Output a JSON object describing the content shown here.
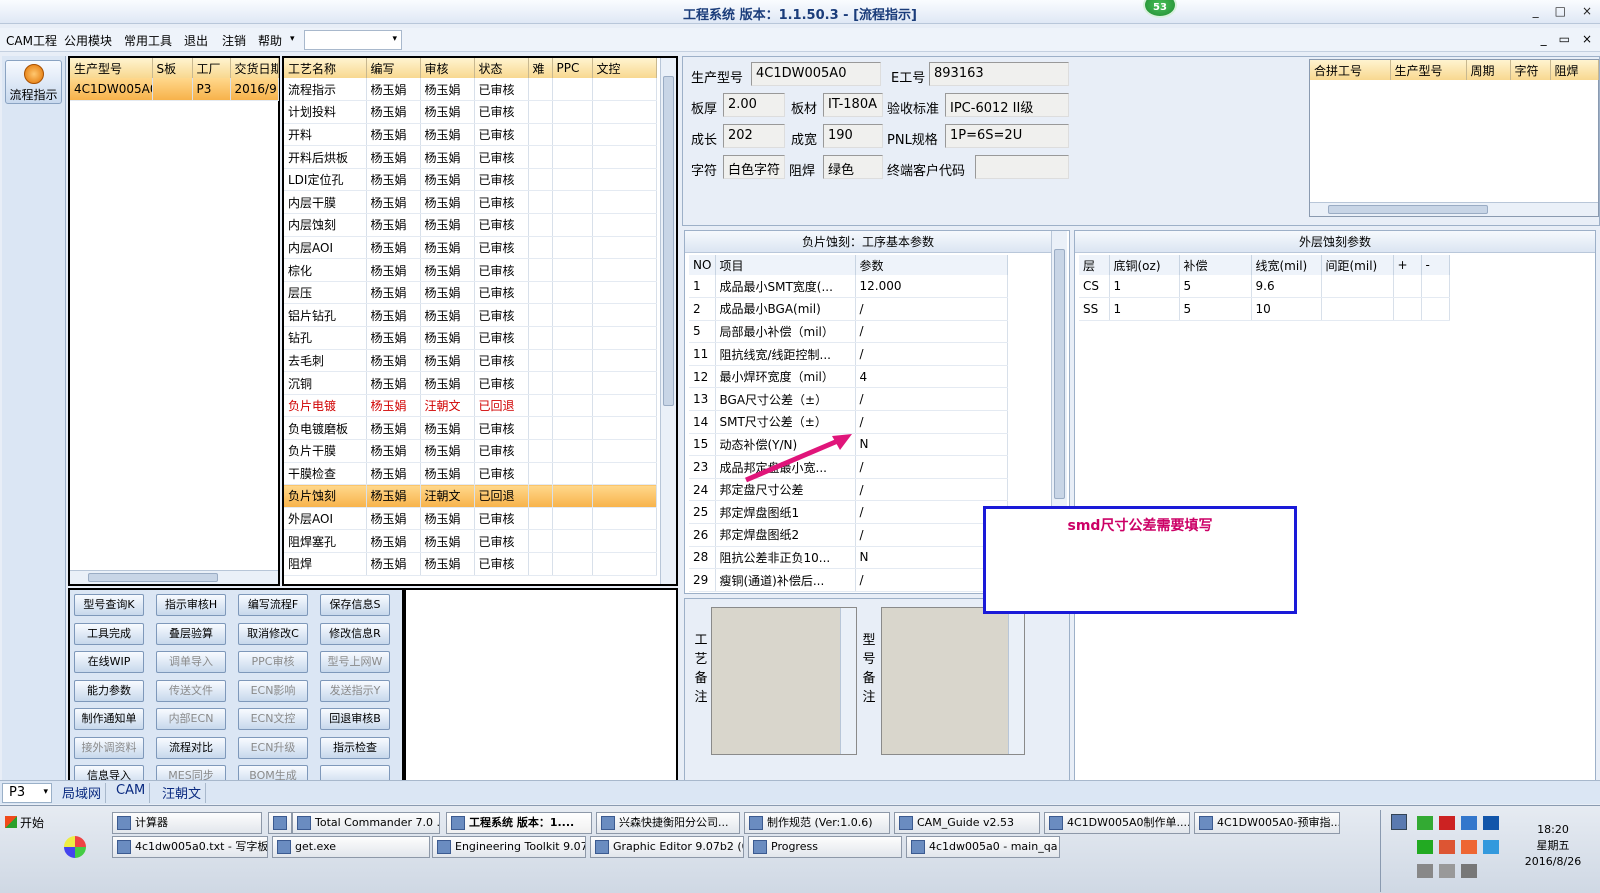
{
  "window": {
    "title": "工程系统  版本：1.1.50.3 - [流程指示]",
    "badge": "53",
    "controls": [
      "_",
      "□",
      "×"
    ],
    "inner_controls": [
      "_",
      "▭",
      "×"
    ]
  },
  "menu": {
    "items": [
      "CAM工程",
      "公用模块",
      "常用工具",
      "退出",
      "注销",
      "帮助"
    ],
    "arrow": "▾"
  },
  "nav": {
    "button_label": "流程指示"
  },
  "model_grid": {
    "headers": [
      "生产型号",
      "S板",
      "工厂",
      "交货日期"
    ],
    "rows": [
      [
        "4C1DW005A0",
        "",
        "P3",
        "2016/9"
      ]
    ]
  },
  "process_grid": {
    "headers": [
      "工艺名称",
      "编写",
      "审核",
      "状态",
      "难",
      "PPC",
      "文控"
    ],
    "rows": [
      [
        "流程指示",
        "杨玉娟",
        "杨玉娟",
        "已审核"
      ],
      [
        "计划投料",
        "杨玉娟",
        "杨玉娟",
        "已审核"
      ],
      [
        "开料",
        "杨玉娟",
        "杨玉娟",
        "已审核"
      ],
      [
        "开料后烘板",
        "杨玉娟",
        "杨玉娟",
        "已审核"
      ],
      [
        "LDI定位孔",
        "杨玉娟",
        "杨玉娟",
        "已审核"
      ],
      [
        "内层干膜",
        "杨玉娟",
        "杨玉娟",
        "已审核"
      ],
      [
        "内层蚀刻",
        "杨玉娟",
        "杨玉娟",
        "已审核"
      ],
      [
        "内层AOI",
        "杨玉娟",
        "杨玉娟",
        "已审核"
      ],
      [
        "棕化",
        "杨玉娟",
        "杨玉娟",
        "已审核"
      ],
      [
        "层压",
        "杨玉娟",
        "杨玉娟",
        "已审核"
      ],
      [
        "铝片钻孔",
        "杨玉娟",
        "杨玉娟",
        "已审核"
      ],
      [
        "钻孔",
        "杨玉娟",
        "杨玉娟",
        "已审核"
      ],
      [
        "去毛刺",
        "杨玉娟",
        "杨玉娟",
        "已审核"
      ],
      [
        "沉铜",
        "杨玉娟",
        "杨玉娟",
        "已审核"
      ],
      [
        "负片电镀",
        "杨玉娟",
        "汪朝文",
        "已回退"
      ],
      [
        "负电镀磨板",
        "杨玉娟",
        "杨玉娟",
        "已审核"
      ],
      [
        "负片干膜",
        "杨玉娟",
        "杨玉娟",
        "已审核"
      ],
      [
        "干膜检查",
        "杨玉娟",
        "杨玉娟",
        "已审核"
      ],
      [
        "负片蚀刻",
        "杨玉娟",
        "汪朝文",
        "已回退"
      ],
      [
        "外层AOI",
        "杨玉娟",
        "杨玉娟",
        "已审核"
      ],
      [
        "阻焊塞孔",
        "杨玉娟",
        "杨玉娟",
        "已审核"
      ],
      [
        "阻焊",
        "杨玉娟",
        "杨玉娟",
        "已审核"
      ]
    ]
  },
  "buttons": [
    [
      "型号查询K",
      "指示审核H",
      "编写流程F",
      "保存信息S"
    ],
    [
      "工具完成",
      "叠层验算",
      "取消修改C",
      "修改信息R"
    ],
    [
      "在线WIP",
      "调单导入",
      "PPC审核",
      "型号上网W"
    ],
    [
      "能力参数",
      "传送文件",
      "ECN影响",
      "发送指示Y"
    ],
    [
      "制作通知单",
      "内部ECN",
      "ECN文控",
      "回退审核B"
    ],
    [
      "接外调资料",
      "流程对比",
      "ECN升级",
      "指示检查"
    ],
    [
      "信息导入",
      "MES同步",
      "BOM生成",
      ""
    ]
  ],
  "info": {
    "labels": {
      "model": "生产型号",
      "eno": "E工号",
      "thick": "板厚",
      "mat": "板材",
      "std": "验收标准",
      "len": "成长",
      "wid": "成宽",
      "pnl": "PNL规格",
      "char": "字符",
      "mask": "阻焊",
      "cust": "终端客户代码"
    },
    "values": {
      "model": "4C1DW005A0",
      "eno": "893163",
      "thick": "2.00",
      "mat": "IT-180A",
      "std": "IPC-6012 II级",
      "len": "202",
      "wid": "190",
      "pnl": "1P=6S=2U",
      "char": "白色字符",
      "mask": "绿色",
      "cust": ""
    }
  },
  "merge_grid": {
    "headers": [
      "合拼工号",
      "生产型号",
      "周期",
      "字符",
      "阻焊"
    ]
  },
  "param_panel": {
    "title": "负片蚀刻：工序基本参数",
    "headers": [
      "NO",
      "项目",
      "参数"
    ],
    "rows": [
      [
        "1",
        "成品最小SMT宽度(...",
        "12.000"
      ],
      [
        "2",
        "成品最小BGA(mil)",
        "/"
      ],
      [
        "5",
        "局部最小补偿（mil）",
        "/"
      ],
      [
        "11",
        "阻抗线宽/线距控制...",
        "/"
      ],
      [
        "12",
        "最小焊环宽度（mil）",
        "4"
      ],
      [
        "13",
        "BGA尺寸公差（±）",
        "/"
      ],
      [
        "14",
        "SMT尺寸公差（±）",
        "/"
      ],
      [
        "15",
        "动态补偿(Y/N)",
        "N"
      ],
      [
        "23",
        "成品邦定盘最小宽...",
        "/"
      ],
      [
        "24",
        "邦定盘尺寸公差",
        "/"
      ],
      [
        "25",
        "邦定焊盘图纸1",
        "/"
      ],
      [
        "26",
        "邦定焊盘图纸2",
        "/"
      ],
      [
        "28",
        "阻抗公差非正负10...",
        "N"
      ],
      [
        "29",
        "瘦铜(通道)补偿后...",
        "/"
      ]
    ]
  },
  "outer_panel": {
    "title": "外层蚀刻参数",
    "headers": [
      "层",
      "底铜(oz)",
      "补偿",
      "线宽(mil)",
      "间距(mil)",
      "+",
      "-"
    ],
    "rows": [
      [
        "CS",
        "1",
        "5",
        "9.6",
        "",
        "",
        ""
      ],
      [
        "SS",
        "1",
        "5",
        "10",
        "",
        "",
        ""
      ]
    ]
  },
  "memo": {
    "left_label": "工艺备注",
    "right_label": "型号备注"
  },
  "callout": {
    "text": "smd尺寸公差需要填写"
  },
  "status_tabs": {
    "combo": "P3",
    "tabs": [
      "局域网",
      "CAM",
      "汪朝文"
    ]
  },
  "taskbar": {
    "start": "开始",
    "row1": [
      "计算器",
      "",
      "Total Commander 7.0 ...",
      "工程系统  版本：1....",
      "兴森快捷衡阳分公司...",
      "制作规范 (Ver:1.0.6)",
      "CAM_Guide v2.53",
      "4C1DW005A0制作单....",
      "4C1DW005A0-预审指..."
    ],
    "row2": [
      "4c1dw005a0.txt - 写字板",
      "get.exe",
      "Engineering Toolkit 9.07...",
      "Graphic Editor 9.07b2 (0...",
      "Progress",
      "4c1dw005a0 - main_qa"
    ],
    "clock": "18:20",
    "weekday": "星期五",
    "date": "2016/8/26"
  }
}
